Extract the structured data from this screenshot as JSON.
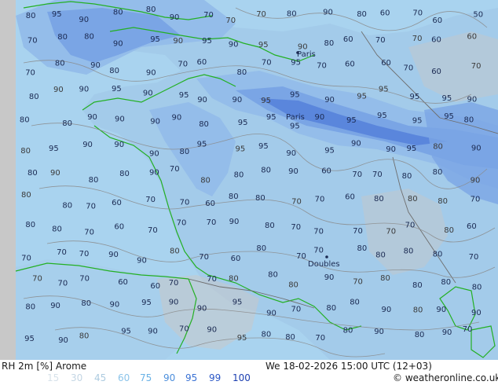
{
  "map": {
    "colors": {
      "land_grey": "#c8c8c8",
      "sea": "#a9d3ef",
      "rh90": "#94bdea",
      "rh95": "#7aa5e5",
      "rh99": "#5a86dc",
      "coast": "#23b023",
      "border": "#6e6e6e",
      "contour": "#8a8a8a"
    },
    "cities": {
      "paris": "Paris",
      "doubles": "Doubles"
    },
    "contour_labels": [
      "80",
      "95",
      "90",
      "80",
      "80",
      "90",
      "70",
      "70",
      "70",
      "80",
      "90",
      "80",
      "60",
      "70",
      "60",
      "50",
      "70",
      "80",
      "80",
      "90",
      "95",
      "90",
      "95",
      "90",
      "95",
      "90",
      "80",
      "60",
      "70",
      "70",
      "60",
      "60",
      "70",
      "80",
      "90",
      "80",
      "90",
      "70",
      "60",
      "80",
      "70",
      "95",
      "70",
      "60",
      "60",
      "70",
      "60",
      "70",
      "80",
      "90",
      "90",
      "95",
      "90",
      "95",
      "90",
      "90",
      "95",
      "95",
      "90",
      "95",
      "95",
      "95",
      "95",
      "90",
      "80",
      "80",
      "90",
      "90",
      "90",
      "90",
      "80",
      "95",
      "95",
      "95",
      "90",
      "95",
      "95",
      "95",
      "95",
      "80",
      "80",
      "95",
      "90",
      "90",
      "90",
      "80",
      "95",
      "95",
      "95",
      "90",
      "95",
      "90",
      "90",
      "95",
      "80",
      "90",
      "80",
      "90",
      "80",
      "80",
      "90",
      "70",
      "80",
      "80",
      "80",
      "90",
      "60",
      "70",
      "70",
      "80",
      "80",
      "90",
      "80",
      "80",
      "70",
      "60",
      "70",
      "70",
      "60",
      "80",
      "80",
      "70",
      "70",
      "60",
      "80",
      "80",
      "80",
      "70",
      "80",
      "80",
      "70",
      "60",
      "70",
      "70",
      "70",
      "90",
      "80",
      "70",
      "70",
      "70",
      "70",
      "70",
      "80",
      "60",
      "70",
      "70",
      "70",
      "90",
      "90",
      "80",
      "70",
      "60",
      "80",
      "70",
      "70",
      "80",
      "80",
      "80",
      "80",
      "70",
      "70",
      "70",
      "70",
      "60",
      "60",
      "70",
      "70",
      "80",
      "80",
      "80",
      "90",
      "70",
      "80",
      "80",
      "80",
      "80",
      "80",
      "90",
      "80",
      "90",
      "95",
      "90",
      "90",
      "95",
      "90",
      "70",
      "80",
      "80",
      "90",
      "80",
      "90",
      "90",
      "95",
      "90",
      "80",
      "95",
      "90",
      "70",
      "90",
      "95",
      "80",
      "80",
      "70",
      "80",
      "90",
      "80",
      "90",
      "70",
      "80",
      "90",
      "80"
    ]
  },
  "footer": {
    "title": "RH 2m [%] Arome",
    "datetime": "We 18-02-2026 15:00 UTC (12+03)",
    "credit": "© weatheronline.co.uk",
    "legend": [
      {
        "label": "15",
        "color": "#d7e2ea"
      },
      {
        "label": "30",
        "color": "#c4d6e4"
      },
      {
        "label": "45",
        "color": "#adcbe0"
      },
      {
        "label": "60",
        "color": "#8cc4ea"
      },
      {
        "label": "75",
        "color": "#69b2e6"
      },
      {
        "label": "90",
        "color": "#4d8fdc"
      },
      {
        "label": "95",
        "color": "#3a72d4"
      },
      {
        "label": "99",
        "color": "#2b57c6"
      },
      {
        "label": "100",
        "color": "#1c3fb0"
      }
    ]
  }
}
